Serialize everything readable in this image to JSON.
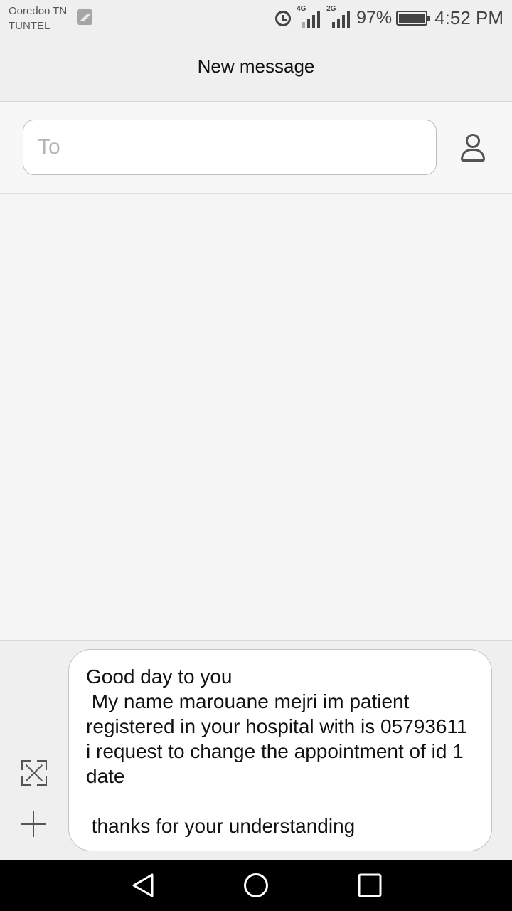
{
  "status_bar": {
    "carrier_primary": "Ooredoo TN",
    "carrier_secondary": "TUNTEL",
    "signal_1_tech": "4G",
    "signal_2_tech": "2G",
    "battery_percent": "97%",
    "time": "4:52 PM",
    "icons": [
      "gallery-icon",
      "alarm-icon",
      "signal-icon",
      "battery-icon"
    ]
  },
  "header": {
    "title": "New message"
  },
  "recipient": {
    "placeholder": "To",
    "value": "",
    "contact_icon": "person-icon"
  },
  "compose": {
    "message_text": "Good day to you\n My name marouane mejri im patient registered in your hospital with is 05793611 i request to change the appointment of id 1 date\n\n thanks for your understanding",
    "expand_icon": "expand-icon",
    "add_icon": "plus-icon"
  },
  "navbar": {
    "icons": [
      "back-icon",
      "home-icon",
      "recent-apps-icon"
    ]
  }
}
